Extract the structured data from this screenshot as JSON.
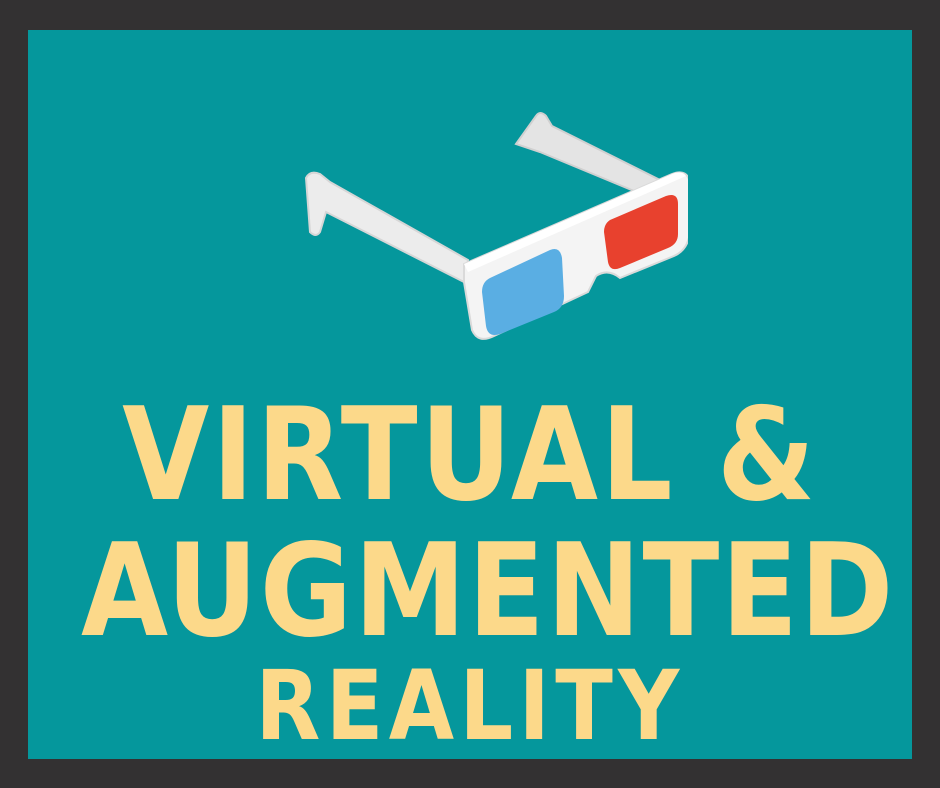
{
  "poster": {
    "line1": "VIRTUAL &",
    "line2": "AUGMENTED",
    "line3": "REALITY"
  },
  "illustration": {
    "icon": "3d-glasses-icon",
    "colors": {
      "background": "#05979c",
      "frame": "#333132",
      "text": "#fcd98a",
      "lens_left": "#5aaee3",
      "lens_right": "#e8412e",
      "glasses_body": "#f3f3f3"
    }
  }
}
